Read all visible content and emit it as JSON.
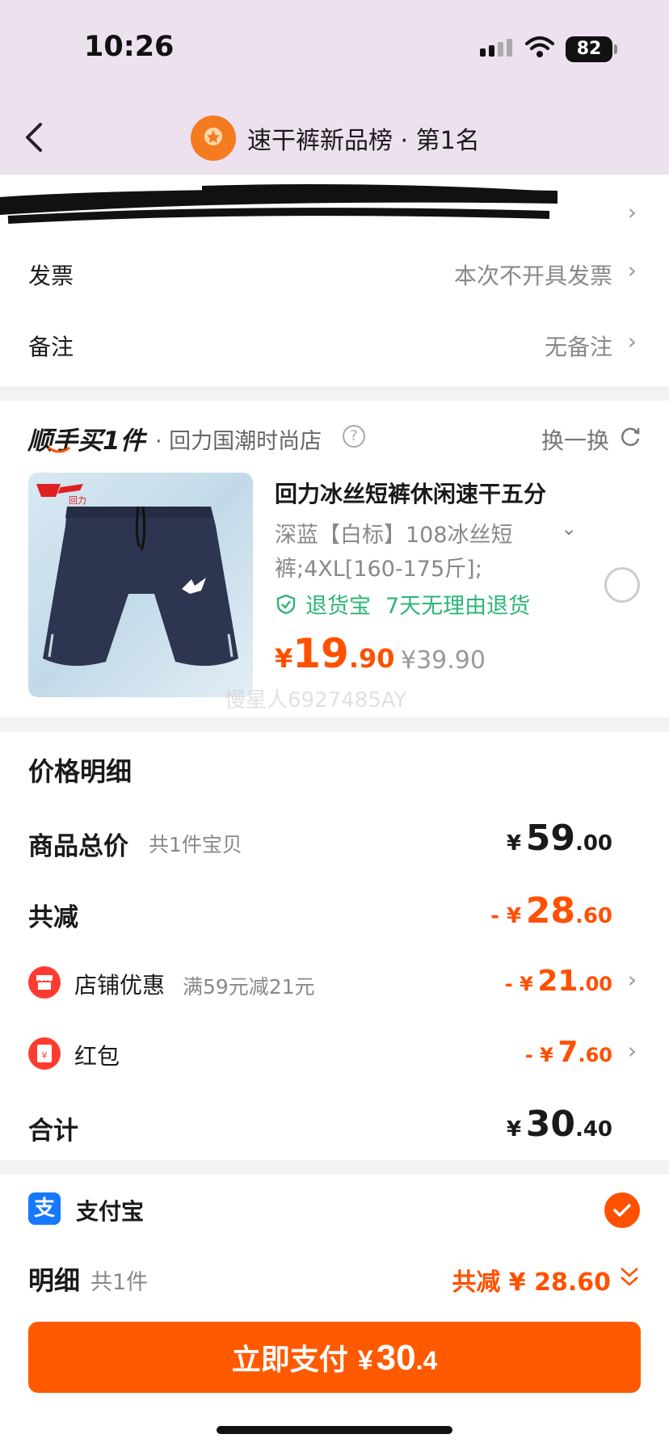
{
  "status_bar": {
    "time": "10:26",
    "battery": "82"
  },
  "header": {
    "title": "速干裤新品榜 · 第1名"
  },
  "invoice": {
    "label": "发票",
    "value": "本次不开具发票"
  },
  "remark": {
    "label": "备注",
    "value": "无备注"
  },
  "add_on": {
    "logo_prefix": "顺手买",
    "logo_suffix": "1件",
    "shop_name": "· 回力国潮时尚店",
    "swap_label": "换一换",
    "product": {
      "title": "回力冰丝短裤休闲速干五分",
      "spec_line1": "深蓝【白标】108冰丝短",
      "spec_line2": "裤;4XL[160-175斤];",
      "return_badge": "退货宝",
      "return_policy": "7天无理由退货",
      "price_currency": "¥",
      "price_int": "19",
      "price_dec": ".90",
      "price_old": "¥39.90",
      "image_brand": "回力"
    },
    "watermark": "慢星人6927485AY"
  },
  "price_detail": {
    "title": "价格明细",
    "goods_total_label": "商品总价",
    "goods_total_count": "共1件宝贝",
    "goods_total": {
      "cur": "¥",
      "int": "59",
      "dec": ".00"
    },
    "total_discount_label": "共减",
    "total_discount": {
      "cur": "- ¥",
      "int": "28",
      "dec": ".60"
    },
    "shop_discount_label": "店铺优惠",
    "shop_discount_rule": "满59元减21元",
    "shop_discount": {
      "cur": "- ¥",
      "int": "21",
      "dec": ".00"
    },
    "red_packet_label": "红包",
    "red_packet": {
      "cur": "- ¥",
      "int": "7",
      "dec": ".60"
    },
    "sum_label": "合计",
    "sum": {
      "cur": "¥",
      "int": "30",
      "dec": ".40"
    }
  },
  "payment": {
    "method_label": "支付宝",
    "method_icon_char": "支",
    "detail_label": "明细",
    "detail_count": "共1件",
    "detail_discount": "共减 ¥ 28.60"
  },
  "pay_button": {
    "label": "立即支付",
    "cur": "¥",
    "int": "30",
    "dec": ".4"
  },
  "colors": {
    "accent": "#ff5000",
    "header_bg": "#ede0ef",
    "green": "#2bb673",
    "alipay": "#1677ff"
  }
}
